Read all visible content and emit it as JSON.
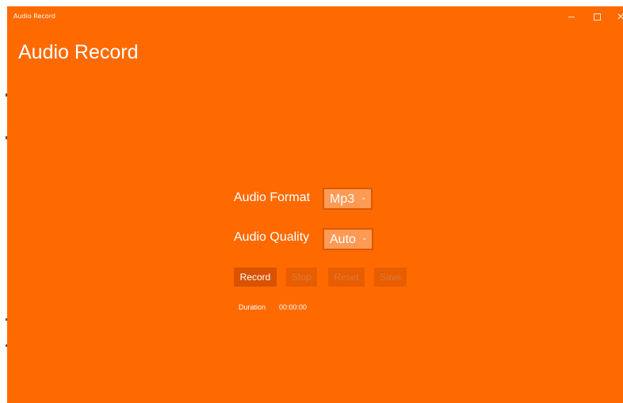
{
  "window": {
    "title": "Audio Record",
    "controls": {
      "minimize": "minimize-icon",
      "maximize": "maximize-icon",
      "close": "close-icon"
    }
  },
  "header": {
    "title": "Audio Record"
  },
  "form": {
    "format_label": "Audio Format",
    "format_value": "Mp3",
    "quality_label": "Audio Quality",
    "quality_value": "Auto"
  },
  "buttons": {
    "record": "Record",
    "stop": "Stop",
    "reset": "Reset",
    "save": "Save"
  },
  "status": {
    "duration_label": "Duration",
    "duration_value": "00:00:00"
  },
  "colors": {
    "accent": "#ff6a00",
    "button_active": "#d95300",
    "button_disabled": "#e85d00",
    "combo_fill": "#ff9a55"
  }
}
